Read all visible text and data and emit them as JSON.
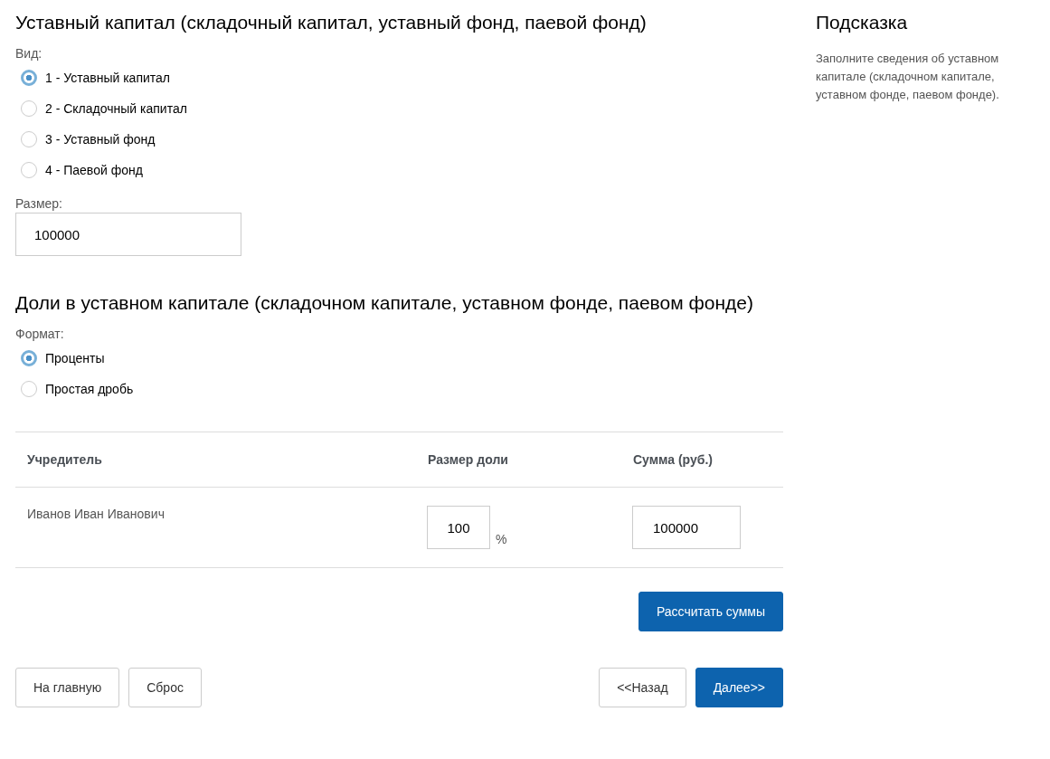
{
  "capital": {
    "title": "Уставный капитал (складочный капитал, уставный фонд, паевой фонд)",
    "type_label": "Вид:",
    "types": [
      {
        "label": "1 - Уставный капитал",
        "selected": true
      },
      {
        "label": "2 - Складочный капитал",
        "selected": false
      },
      {
        "label": "3 - Уставный фонд",
        "selected": false
      },
      {
        "label": "4 - Паевой фонд",
        "selected": false
      }
    ],
    "size_label": "Размер:",
    "size_value": "100000"
  },
  "shares": {
    "title": "Доли в уставном капитале (складочном капитале, уставном фонде, паевом фонде)",
    "format_label": "Формат:",
    "formats": [
      {
        "label": "Проценты",
        "selected": true
      },
      {
        "label": "Простая дробь",
        "selected": false
      }
    ],
    "table": {
      "columns": [
        "Учредитель",
        "Размер доли",
        "Сумма (руб.)"
      ],
      "rows": [
        {
          "founder": "Иванов Иван Иванович",
          "share": "100",
          "unit": "%",
          "sum": "100000"
        }
      ]
    },
    "calc_button": "Рассчитать суммы"
  },
  "footer": {
    "left_buttons": [
      {
        "label": "На главную",
        "kind": "default"
      },
      {
        "label": "Сброс",
        "kind": "default"
      }
    ],
    "right_buttons": [
      {
        "label": "<<Назад",
        "kind": "default"
      },
      {
        "label": "Далее>>",
        "kind": "primary"
      }
    ]
  },
  "hint": {
    "title": "Подсказка",
    "text": "Заполните сведения об уставном капитале (складочном капитале, уставном фонде, паевом фонде)."
  }
}
